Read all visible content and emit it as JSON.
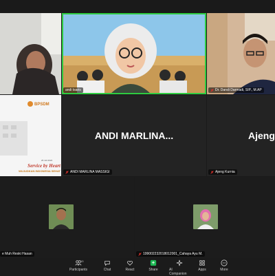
{
  "meeting": {
    "participants": [
      {
        "name": "",
        "muted": true
      },
      {
        "name": "andi tsaris",
        "muted": false,
        "speaking": true
      },
      {
        "name": "Dr. Dandi Darmadi, SIP., M.AP",
        "muted": true
      },
      {
        "name": "ANDI MARLINA MASSIGI",
        "display": "ANDI MARLINA...",
        "muted": true
      },
      {
        "name": "Ajeng Kurnia",
        "display": "Ajeng",
        "muted": true
      },
      {
        "name": "e Muh Reski Hasan",
        "muted": true
      },
      {
        "name": "199002232018012001_Cahaya Ayu M.",
        "muted": true
      }
    ],
    "slide": {
      "brand": "BPSDM",
      "date": "26 Juli 2024",
      "title": "Service by Heart",
      "subtitle": "WUJUDKAN INDONESIA SEHAT"
    }
  },
  "toolbar": {
    "participants_count": "13",
    "items": [
      {
        "label": "Participants",
        "icon": "participants-icon"
      },
      {
        "label": "Chat",
        "icon": "chat-icon"
      },
      {
        "label": "React",
        "icon": "react-icon"
      },
      {
        "label": "Share",
        "icon": "share-icon"
      },
      {
        "label": "AI Companion",
        "icon": "ai-companion-icon"
      },
      {
        "label": "Apps",
        "icon": "apps-icon"
      },
      {
        "label": "More",
        "icon": "more-icon"
      }
    ]
  },
  "colors": {
    "speaking_border": "#2ecc40",
    "share_green": "#1db954",
    "mute_red": "#e0312b"
  }
}
